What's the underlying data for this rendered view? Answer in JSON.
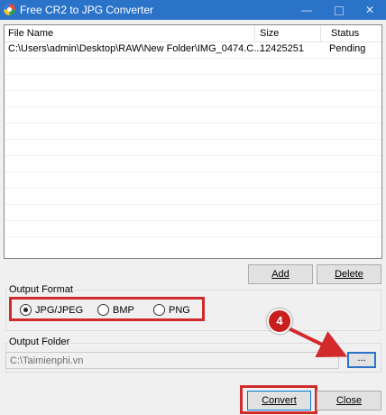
{
  "window": {
    "title": "Free CR2 to JPG Converter",
    "minimize_glyph": "—",
    "close_glyph": "✕"
  },
  "file_list": {
    "columns": [
      "File Name",
      "Size",
      "Status"
    ],
    "rows": [
      {
        "file_name": "C:\\Users\\admin\\Desktop\\RAW\\New Folder\\IMG_0474.C...",
        "size": "12425251",
        "status": "Pending"
      }
    ]
  },
  "list_buttons": {
    "add_label": "Add",
    "delete_label": "Delete"
  },
  "output_format": {
    "label": "Output Format",
    "options": [
      {
        "label": "JPG/JPEG",
        "selected": true
      },
      {
        "label": "BMP",
        "selected": false
      },
      {
        "label": "PNG",
        "selected": false
      }
    ]
  },
  "output_folder": {
    "label": "Output Folder",
    "value": "C:\\Taimienphi.vn",
    "browse_label": "..."
  },
  "actions": {
    "convert_label": "Convert",
    "close_label": "Close"
  },
  "annotation": {
    "step_number": "4",
    "color": "#d22a2a"
  },
  "colors": {
    "titlebar": "#2b73c9",
    "highlight": "#d22a2a",
    "selection_border": "#0078d7"
  }
}
